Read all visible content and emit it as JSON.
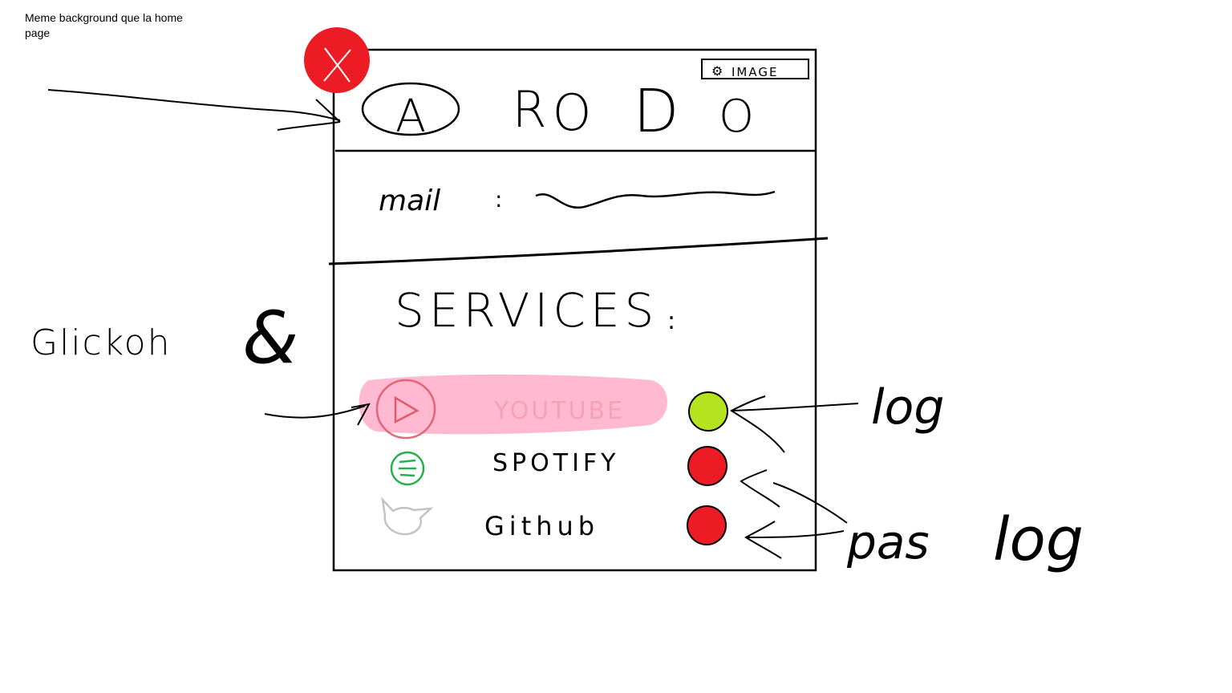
{
  "note": "Meme background que la home page",
  "header": {
    "image_badge": "IMAGE",
    "title_letters": [
      "A",
      "R",
      "O",
      "D",
      "O"
    ]
  },
  "mail": {
    "label": "mail",
    "colon": ":"
  },
  "services": {
    "title": "SERVICES",
    "colon": ":",
    "items": [
      {
        "name": "YOUTUBE",
        "status_color": "#b5e31f",
        "icon": "youtube-icon",
        "icon_color": "#e05a6d"
      },
      {
        "name": "SPOTIFY",
        "status_color": "#ed1c24",
        "icon": "spotify-icon",
        "icon_color": "#22b14c"
      },
      {
        "name": "Github",
        "status_color": "#ed1c24",
        "icon": "github-icon",
        "icon_color": "#c3c3c3"
      }
    ]
  },
  "annotations": {
    "click_on": "Glickoh",
    "click_on_letter": "&",
    "log": "log",
    "pas": "pas",
    "pas_log": "log"
  },
  "colors": {
    "close_red": "#ed1c24",
    "highlight_pink": "#ffaec9",
    "stroke": "#000000"
  }
}
